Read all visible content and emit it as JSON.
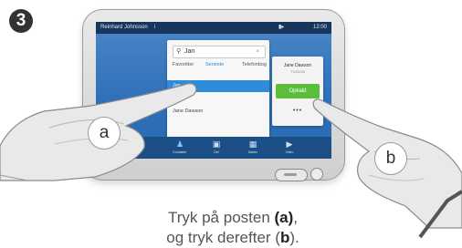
{
  "step_number": "3",
  "device": {
    "statusbar": {
      "user": "Reinhard Johnsson",
      "info": "i",
      "time": "12:00"
    },
    "search": {
      "value": "Jan",
      "clear": "×"
    },
    "tabs": [
      {
        "label": "Favoritter"
      },
      {
        "label": "Seneste"
      },
      {
        "label": "Telefonbog"
      }
    ],
    "rows": [
      {
        "label": "Jan"
      },
      {
        "label": "Jane Dawson"
      }
    ],
    "contact_card": {
      "name": "Jane Dawson",
      "number": "7343128",
      "call_label": "Opkald",
      "more": "•••"
    },
    "dock": [
      {
        "icon": "user-icon",
        "label": "Kontakter"
      },
      {
        "icon": "share-icon",
        "label": "Del"
      },
      {
        "icon": "calendar-icon",
        "label": "Møder"
      },
      {
        "icon": "video-icon",
        "label": "Video"
      }
    ]
  },
  "callouts": {
    "a": "a",
    "b": "b"
  },
  "instruction": {
    "line1_pre": "Tryk på posten ",
    "line1_bold": "(a)",
    "line1_post": ",",
    "line2_pre": "og tryk derefter (",
    "line2_bold": "b",
    "line2_post": ")."
  }
}
